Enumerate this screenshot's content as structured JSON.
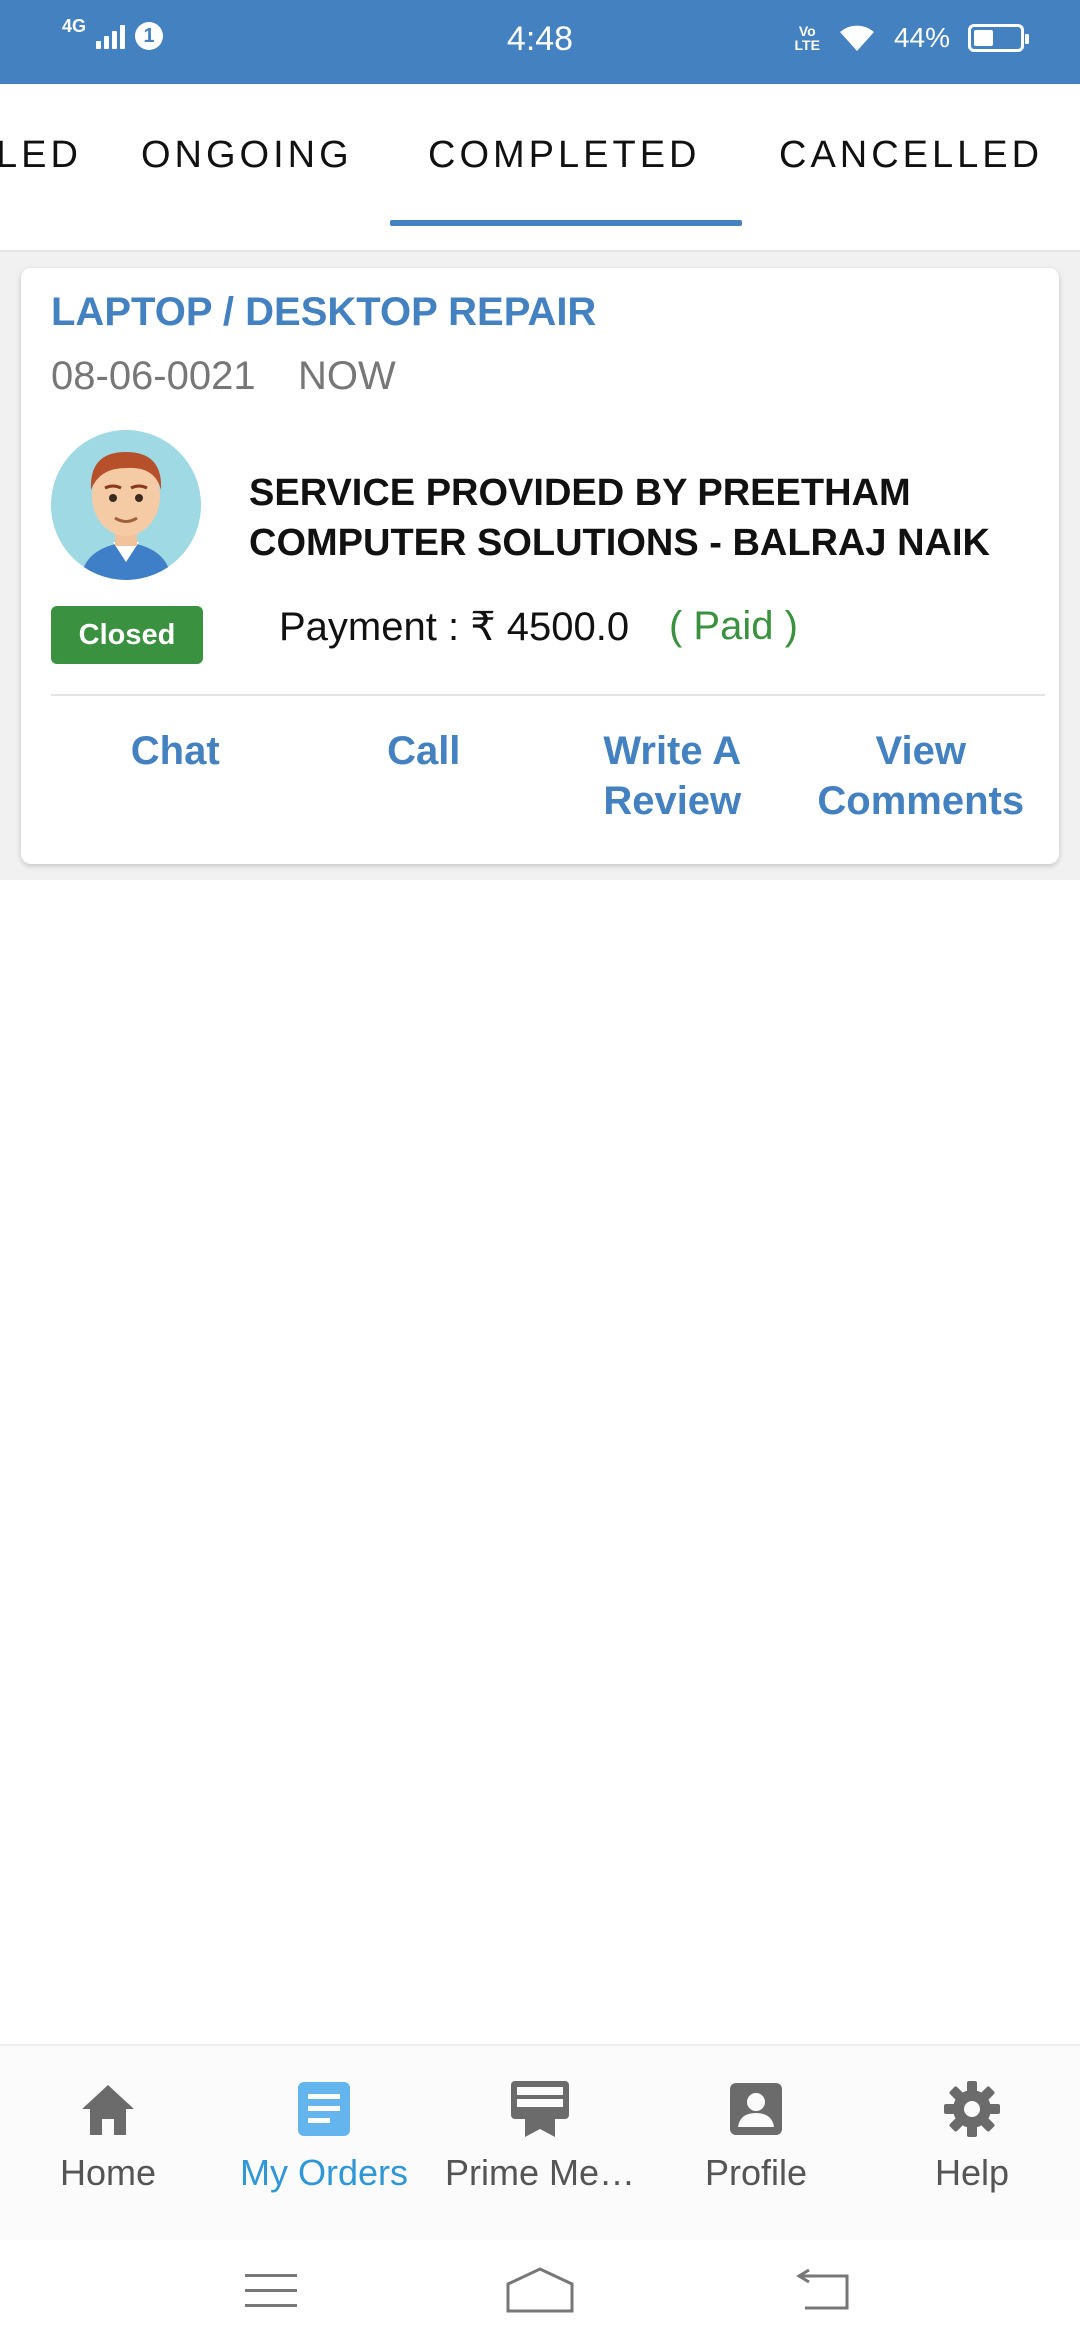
{
  "status_bar": {
    "network": "4G",
    "notification_count": "1",
    "time": "4:48",
    "volte": "Vo LTE",
    "battery_percent": "44%",
    "battery_level": 0.44
  },
  "tabs": [
    {
      "label": "CANCELLED",
      "partial_label": "LED"
    },
    {
      "label": "ONGOING"
    },
    {
      "label": "COMPLETED",
      "active": true
    },
    {
      "label": "CANCELLED"
    }
  ],
  "order": {
    "category": "LAPTOP / DESKTOP REPAIR",
    "date": "08-06-0021",
    "when": "NOW",
    "provider_line1": "SERVICE PROVIDED BY PREETHAM",
    "provider_line2": "COMPUTER SOLUTIONS - BALRAJ NAIK",
    "status": "Closed",
    "payment": "Payment : ₹ 4500.0",
    "payment_status": "( Paid )",
    "actions": {
      "chat": "Chat",
      "call": "Call",
      "review_line1": "Write A",
      "review_line2": "Review",
      "comments_line1": "View",
      "comments_line2": "Comments"
    }
  },
  "bottom_nav": [
    {
      "label": "Home",
      "icon": "home-icon"
    },
    {
      "label": "My Orders",
      "icon": "orders-icon",
      "active": true
    },
    {
      "label": "Prime Me…",
      "icon": "prime-membership-icon"
    },
    {
      "label": "Profile",
      "icon": "profile-icon"
    },
    {
      "label": "Help",
      "icon": "gear-icon"
    }
  ],
  "colors": {
    "primary": "#4381c1",
    "success": "#3a913f",
    "active_nav": "#2d97d7"
  }
}
